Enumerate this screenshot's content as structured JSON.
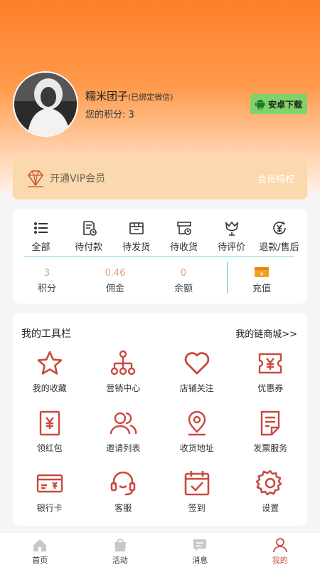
{
  "profile": {
    "name": "糯米团子",
    "bound_note": "(已绑定微信)",
    "points_label": "您的积分: 3",
    "download_label": "安卓下载"
  },
  "vip": {
    "open_label": "开通VIP会员",
    "privilege_label": "会员特权"
  },
  "orders": {
    "items": [
      {
        "label": "全部",
        "icon": "list-icon"
      },
      {
        "label": "待付款",
        "icon": "payment-pending-icon"
      },
      {
        "label": "待发货",
        "icon": "box-icon"
      },
      {
        "label": "待收货",
        "icon": "receive-icon"
      },
      {
        "label": "待评价",
        "icon": "review-icon"
      },
      {
        "label": "退款/售后",
        "icon": "refund-icon"
      }
    ]
  },
  "stats": {
    "points": {
      "value": "3",
      "label": "积分"
    },
    "commission": {
      "value": "0.46",
      "label": "佣金"
    },
    "balance": {
      "value": "0",
      "label": "余额"
    },
    "recharge_label": "充值"
  },
  "tools": {
    "title": "我的工具栏",
    "mall_link": "我的链商城>>",
    "items": [
      {
        "label": "我的收藏",
        "icon": "star-icon"
      },
      {
        "label": "营销中心",
        "icon": "network-icon"
      },
      {
        "label": "店铺关注",
        "icon": "heart-icon"
      },
      {
        "label": "优惠券",
        "icon": "coupon-icon"
      },
      {
        "label": "领红包",
        "icon": "red-envelope-icon"
      },
      {
        "label": "邀请列表",
        "icon": "users-icon"
      },
      {
        "label": "收货地址",
        "icon": "location-icon"
      },
      {
        "label": "发票服务",
        "icon": "invoice-icon"
      },
      {
        "label": "银行卡",
        "icon": "bank-card-icon"
      },
      {
        "label": "客服",
        "icon": "headset-icon"
      },
      {
        "label": "签到",
        "icon": "calendar-check-icon"
      },
      {
        "label": "设置",
        "icon": "gear-icon"
      }
    ]
  },
  "tabbar": {
    "items": [
      {
        "label": "首页",
        "icon": "home-icon"
      },
      {
        "label": "活动",
        "icon": "bag-icon"
      },
      {
        "label": "消息",
        "icon": "message-icon"
      },
      {
        "label": "我的",
        "icon": "user-icon",
        "active": true
      }
    ]
  },
  "colors": {
    "accent": "#c94a3e",
    "header_orange": "#ff7e2a",
    "android_green": "#7fd36a",
    "divider_teal": "#3cc7c7"
  }
}
